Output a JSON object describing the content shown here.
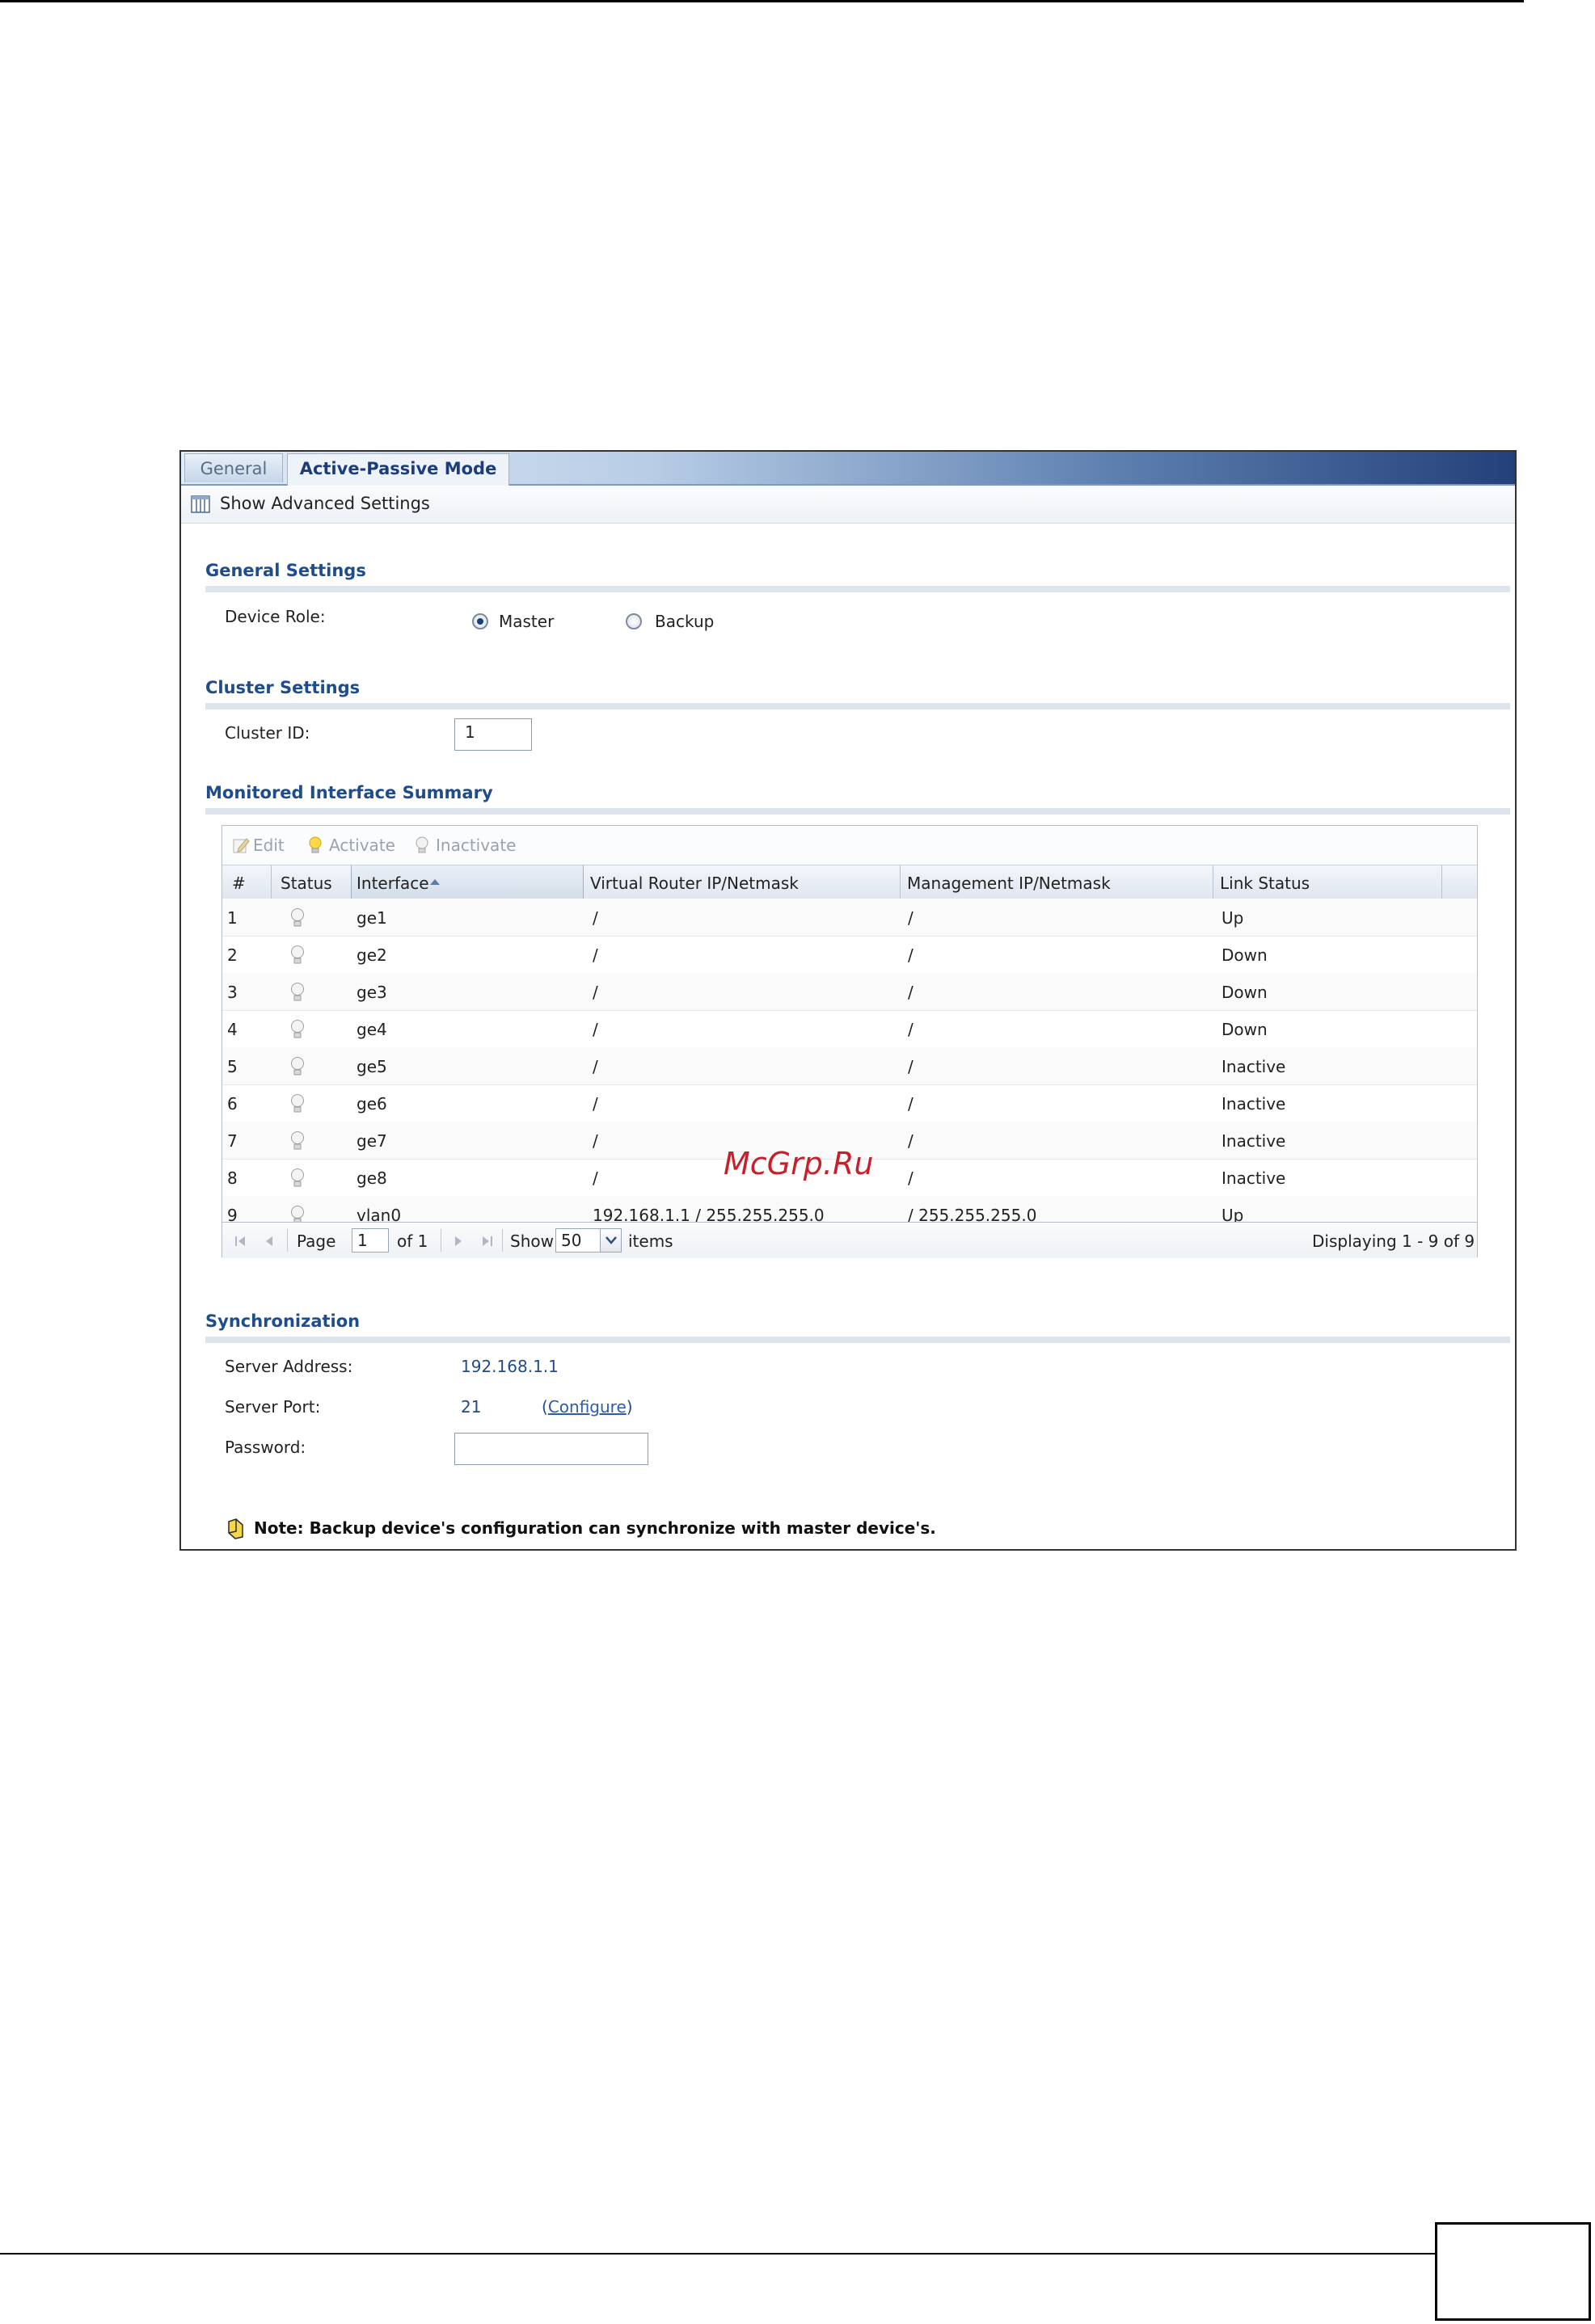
{
  "tabs": [
    {
      "label": "General",
      "active": false
    },
    {
      "label": "Active-Passive Mode",
      "active": true
    }
  ],
  "advanced": {
    "label": "Show Advanced Settings",
    "icon": "columns-icon"
  },
  "general_settings": {
    "title": "General Settings",
    "device_role_label": "Device Role:",
    "options": [
      {
        "label": "Master",
        "selected": true
      },
      {
        "label": "Backup",
        "selected": false
      }
    ]
  },
  "cluster_settings": {
    "title": "Cluster Settings",
    "cluster_id_label": "Cluster ID:",
    "cluster_id_value": "1"
  },
  "monitored": {
    "title": "Monitored Interface Summary",
    "toolbar": {
      "edit": "Edit",
      "activate": "Activate",
      "inactivate": "Inactivate"
    },
    "columns": [
      "#",
      "Status",
      "Interface",
      "Virtual Router IP/Netmask",
      "Management IP/Netmask",
      "Link Status"
    ],
    "sorted_column": "Interface",
    "rows": [
      {
        "num": "1",
        "iface": "ge1",
        "vr": "/",
        "mgmt": "/",
        "link": "Up"
      },
      {
        "num": "2",
        "iface": "ge2",
        "vr": "/",
        "mgmt": "/",
        "link": "Down"
      },
      {
        "num": "3",
        "iface": "ge3",
        "vr": "/",
        "mgmt": "/",
        "link": "Down"
      },
      {
        "num": "4",
        "iface": "ge4",
        "vr": "/",
        "mgmt": "/",
        "link": "Down"
      },
      {
        "num": "5",
        "iface": "ge5",
        "vr": "/",
        "mgmt": "/",
        "link": "Inactive"
      },
      {
        "num": "6",
        "iface": "ge6",
        "vr": "/",
        "mgmt": "/",
        "link": "Inactive"
      },
      {
        "num": "7",
        "iface": "ge7",
        "vr": "/",
        "mgmt": "/",
        "link": "Inactive"
      },
      {
        "num": "8",
        "iface": "ge8",
        "vr": "/",
        "mgmt": "/",
        "link": "Inactive"
      },
      {
        "num": "9",
        "iface": "vlan0",
        "vr": "192.168.1.1 / 255.255.255.0",
        "mgmt": "/ 255.255.255.0",
        "link": "Up"
      }
    ],
    "pager": {
      "page_label": "Page",
      "page_value": "1",
      "of_label": "of 1",
      "show_label": "Show",
      "show_value": "50",
      "items_label": "items",
      "displaying": "Displaying 1 - 9 of 9"
    }
  },
  "synchronization": {
    "title": "Synchronization",
    "server_address_label": "Server Address:",
    "server_address_value": "192.168.1.1",
    "server_port_label": "Server Port:",
    "server_port_value": "21",
    "configure_open": "(",
    "configure_link": "Configure",
    "configure_close": ")",
    "password_label": "Password:",
    "password_value": ""
  },
  "note": "Note: Backup device's configuration can synchronize with master device's.",
  "watermark": "McGrp.Ru"
}
